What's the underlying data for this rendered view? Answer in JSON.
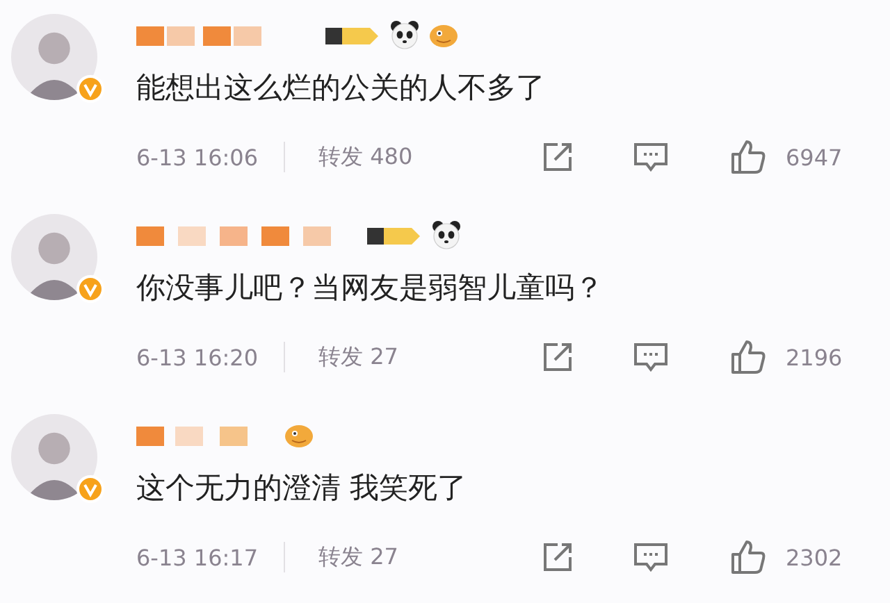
{
  "comments": [
    {
      "verified": true,
      "badges": [
        {
          "kind": "tag"
        },
        {
          "kind": "panda"
        },
        {
          "kind": "fish"
        }
      ],
      "text": "能想出这么烂的公关的人不多了",
      "time": "6-13 16:06",
      "repost_label": "转发",
      "reposts": "480",
      "likes": "6947"
    },
    {
      "verified": true,
      "badges": [
        {
          "kind": "tag"
        },
        {
          "kind": "panda"
        }
      ],
      "text": "你没事儿吧？当网友是弱智儿童吗？",
      "time": "6-13 16:20",
      "repost_label": "转发",
      "reposts": "27",
      "likes": "2196"
    },
    {
      "verified": true,
      "badges": [
        {
          "kind": "fish"
        }
      ],
      "text": "这个无力的澄清 我笑死了",
      "time": "6-13 16:17",
      "repost_label": "转发",
      "reposts": "27",
      "likes": "2302"
    }
  ]
}
